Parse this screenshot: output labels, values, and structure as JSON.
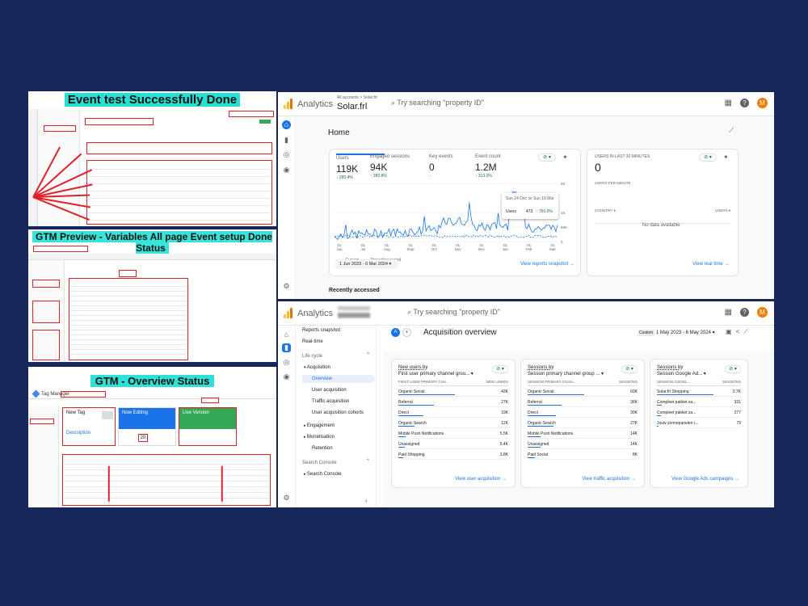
{
  "banners": {
    "event_test": "Event test Successfully Done",
    "gtm_preview": "GTM Preview - Variables All page Event setup Done Status",
    "gtm_overview": "GTM - Overview Status"
  },
  "gtm_overview_panel": {
    "app_name": "Tag Manager",
    "new_tag": "New Tag",
    "description": "Description",
    "now_editing": "Now Editing",
    "container_version": "Live Version",
    "workspace_count": "20"
  },
  "ga_home": {
    "brand": "Analytics",
    "account_path": "All accounts > Solar.frl",
    "property": "Solar.frl",
    "search_placeholder": "Try searching \"property ID\"",
    "avatar_letter": "M",
    "page_title": "Home",
    "metrics": [
      {
        "label": "Users",
        "value": "119K",
        "change": "↑ 280.4%"
      },
      {
        "label": "Engaged sessions",
        "value": "94K",
        "change": "↑ 280.8%"
      },
      {
        "label": "Key events",
        "value": "0",
        "change": "-"
      },
      {
        "label": "Event count",
        "value": "1.2M",
        "change": "↑ 313.0%"
      }
    ],
    "y_ticks": [
      "2K",
      "1K",
      "500",
      "0"
    ],
    "x_ticks": [
      "01 Jun",
      "01 Jul",
      "01 Aug",
      "01 Sept",
      "01 Oct",
      "01 Nov",
      "01 Dec",
      "01 Jan",
      "01 Feb",
      "01 Mar"
    ],
    "legend_custom": "Custom",
    "legend_preceding": "Preceding period",
    "tooltip_range": "Sun 24 Dec vs Sun 19 Mar",
    "tooltip_label": "Users",
    "tooltip_value": "473",
    "tooltip_change": "↑ 760.0%",
    "date_range": "1 Jun 2023 - 6 Mar 2024",
    "view_reports": "View reports snapshot →",
    "recently_accessed": "Recently accessed",
    "realtime_title": "USERS IN LAST 30 MINUTES",
    "realtime_value": "0",
    "realtime_sub": "USERS PER MINUTE",
    "realtime_country": "COUNTRY ▾",
    "realtime_users": "USERS ▾",
    "realtime_nodata": "No data available",
    "view_realtime": "View real time →"
  },
  "ga_acq": {
    "brand": "Analytics",
    "search_placeholder": "Try searching \"property ID\"",
    "avatar_letter": "M",
    "sidebar": [
      {
        "label": "Reports snapshot",
        "indent": 0
      },
      {
        "label": "Real-time",
        "indent": 0
      },
      {
        "label": "Life cycle",
        "indent": 0
      },
      {
        "label": "Acquisition",
        "indent": 1
      },
      {
        "label": "Overview",
        "indent": 2
      },
      {
        "label": "User acquisition",
        "indent": 2
      },
      {
        "label": "Traffic acquisition",
        "indent": 2
      },
      {
        "label": "User acquisition cohorts",
        "indent": 2
      },
      {
        "label": "Engagement",
        "indent": 1
      },
      {
        "label": "Monetisation",
        "indent": 1
      },
      {
        "label": "Retention",
        "indent": 2
      },
      {
        "label": "Search Console",
        "indent": 0
      },
      {
        "label": "Search Console",
        "indent": 1
      }
    ],
    "badge_letter": "A",
    "page_title": "Acquisition overview",
    "custom_label": "Custom",
    "date_range": "1 May 2023 - 6 May 2024",
    "cards": [
      {
        "title": "New users by",
        "subtitle": "First user primary channel grou... ▾",
        "col_a": "FIRST USER PRIMARY CHA...",
        "col_b": "NEW USERS",
        "rows": [
          {
            "label": "Organic Social",
            "value": "43K",
            "frac": 1.0
          },
          {
            "label": "Referral",
            "value": "27K",
            "frac": 0.63
          },
          {
            "label": "Direct",
            "value": "19K",
            "frac": 0.44
          },
          {
            "label": "Organic Search",
            "value": "12K",
            "frac": 0.28
          },
          {
            "label": "Mobile Push Notifications",
            "value": "5.5K",
            "frac": 0.13
          },
          {
            "label": "Unassigned",
            "value": "5.4K",
            "frac": 0.12
          },
          {
            "label": "Paid Shopping",
            "value": "3.8K",
            "frac": 0.09
          }
        ],
        "link": "View user acquisition →"
      },
      {
        "title": "Sessions by",
        "subtitle": "Session primary channel group ... ▾",
        "col_a": "SESSION PRIMARY CHAN...",
        "col_b": "SESSIONS",
        "rows": [
          {
            "label": "Organic Social",
            "value": "60K",
            "frac": 1.0
          },
          {
            "label": "Referral",
            "value": "36K",
            "frac": 0.6
          },
          {
            "label": "Direct",
            "value": "30K",
            "frac": 0.5
          },
          {
            "label": "Organic Search",
            "value": "27K",
            "frac": 0.45
          },
          {
            "label": "Mobile Push Notifications",
            "value": "14K",
            "frac": 0.23
          },
          {
            "label": "Unassigned",
            "value": "14K",
            "frac": 0.23
          },
          {
            "label": "Paid Social",
            "value": "8K",
            "frac": 0.13
          }
        ],
        "link": "View traffic acquisition →"
      },
      {
        "title": "Sessions by",
        "subtitle": "Session Google Ad... ▾",
        "col_a": "SESSION GOOGL...",
        "col_b": "SESSIONS",
        "rows": [
          {
            "label": "Solar.frl Shopping",
            "value": "3.7K",
            "frac": 1.0
          },
          {
            "label": "Compleet pakket sa...",
            "value": "331",
            "frac": 0.09
          },
          {
            "label": "Compleet pakket za...",
            "value": "277",
            "frac": 0.075
          },
          {
            "label": "Jouw zonnepanelen i...",
            "value": "79",
            "frac": 0.02
          }
        ],
        "link": "View Google Ads campaigns →"
      }
    ]
  }
}
